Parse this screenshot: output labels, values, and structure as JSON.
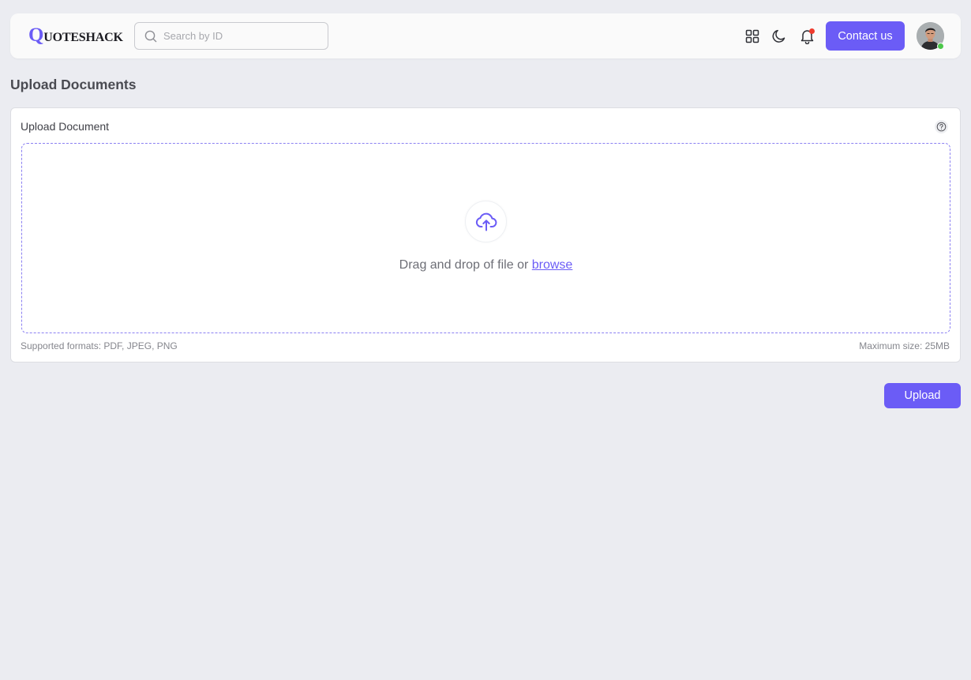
{
  "header": {
    "logo_initial": "Q",
    "logo_rest": "UOTESHACK",
    "search_placeholder": "Search by ID",
    "icons": [
      "grid-icon",
      "moon-icon",
      "bell-icon"
    ],
    "contact_label": "Contact us",
    "avatar_status": "online"
  },
  "page": {
    "title": "Upload Documents"
  },
  "upload_card": {
    "title": "Upload Document",
    "drop_text": "Drag and drop of file or ",
    "browse_label": "browse",
    "supported_formats": "Supported formats: PDF, JPEG, PNG",
    "max_size": "Maximum size: 25MB"
  },
  "actions": {
    "upload_label": "Upload"
  },
  "colors": {
    "accent": "#6b5cf6",
    "background": "#ebecf1",
    "notification": "#ef3b2d",
    "online": "#4cc74a"
  }
}
